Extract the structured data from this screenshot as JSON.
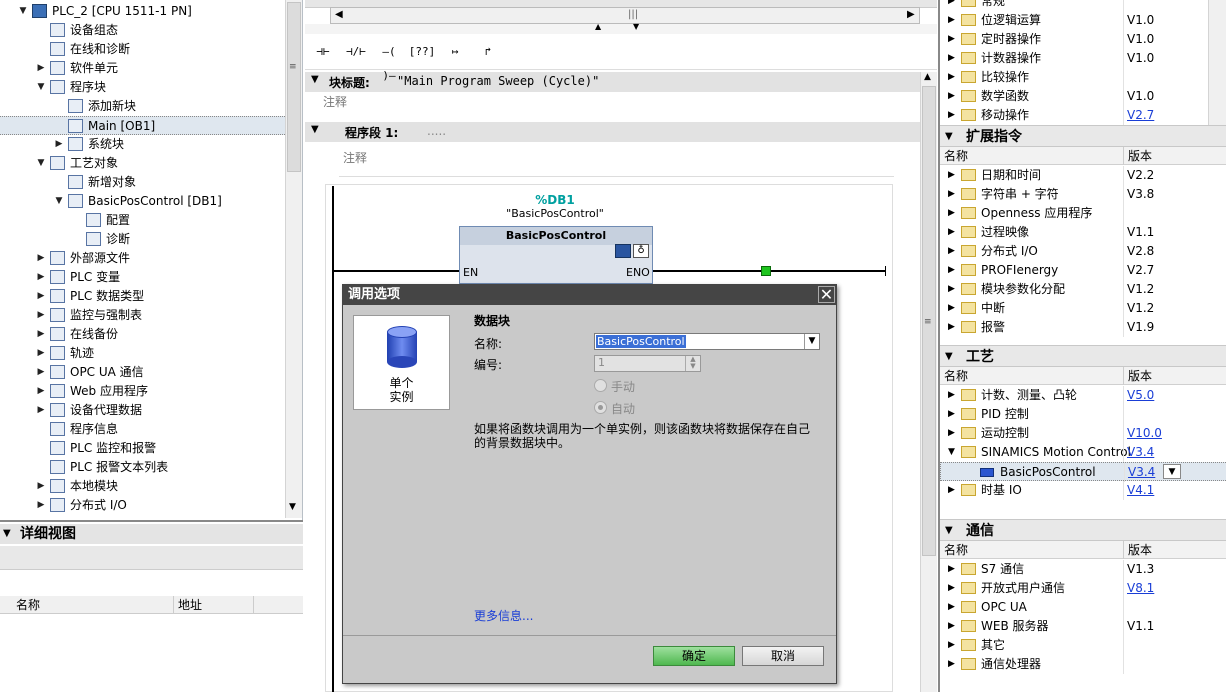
{
  "tree": {
    "root": "PLC_2 [CPU 1511-1 PN]",
    "items": [
      {
        "label": "设备组态",
        "icon": "device-config-icon",
        "arrow": ""
      },
      {
        "label": "在线和诊断",
        "icon": "online-diagnostics-icon",
        "arrow": ""
      },
      {
        "label": "软件单元",
        "icon": "software-unit-icon",
        "arrow": "▶"
      },
      {
        "label": "程序块",
        "icon": "program-blocks-icon",
        "arrow": "▼"
      },
      {
        "label": "添加新块",
        "icon": "add-block-icon",
        "arrow": ""
      },
      {
        "label": "Main [OB1]",
        "icon": "ob-block-icon",
        "arrow": ""
      },
      {
        "label": "系统块",
        "icon": "system-blocks-icon",
        "arrow": "▶"
      },
      {
        "label": "工艺对象",
        "icon": "technology-objects-icon",
        "arrow": "▼"
      },
      {
        "label": "新增对象",
        "icon": "add-object-icon",
        "arrow": ""
      },
      {
        "label": "BasicPosControl [DB1]",
        "icon": "axis-object-icon",
        "arrow": "▼"
      },
      {
        "label": "配置",
        "icon": "config-icon",
        "arrow": ""
      },
      {
        "label": "诊断",
        "icon": "diagnostics-icon",
        "arrow": ""
      },
      {
        "label": "外部源文件",
        "icon": "external-source-icon",
        "arrow": "▶"
      },
      {
        "label": "PLC 变量",
        "icon": "plc-tags-icon",
        "arrow": "▶"
      },
      {
        "label": "PLC 数据类型",
        "icon": "plc-datatype-icon",
        "arrow": "▶"
      },
      {
        "label": "监控与强制表",
        "icon": "watch-table-icon",
        "arrow": "▶"
      },
      {
        "label": "在线备份",
        "icon": "online-backup-icon",
        "arrow": "▶"
      },
      {
        "label": "轨迹",
        "icon": "trace-icon",
        "arrow": "▶"
      },
      {
        "label": "OPC UA 通信",
        "icon": "opcua-icon",
        "arrow": "▶"
      },
      {
        "label": "Web 应用程序",
        "icon": "web-app-icon",
        "arrow": "▶"
      },
      {
        "label": "设备代理数据",
        "icon": "device-proxy-icon",
        "arrow": "▶"
      },
      {
        "label": "程序信息",
        "icon": "program-info-icon",
        "arrow": ""
      },
      {
        "label": "PLC 监控和报警",
        "icon": "plc-alarms-icon",
        "arrow": ""
      },
      {
        "label": "PLC 报警文本列表",
        "icon": "alarm-text-icon",
        "arrow": ""
      },
      {
        "label": "本地模块",
        "icon": "local-modules-icon",
        "arrow": "▶"
      },
      {
        "label": "分布式 I/O",
        "icon": "distributed-io-icon",
        "arrow": "▶"
      }
    ]
  },
  "detail_view": {
    "title": "详细视图",
    "col_name": "名称",
    "col_address": "地址"
  },
  "editor": {
    "toolbar": [
      "⊣⊢",
      "⊣/⊢",
      "–( )–",
      "[??]",
      "↦",
      "↱"
    ],
    "block_title_label": "块标题:",
    "block_title_value": "\"Main Program Sweep (Cycle)\"",
    "comment": "注释",
    "network_label": "程序段 1:",
    "network_dots": ".....",
    "network_comment": "注释",
    "db_address": "%DB1",
    "db_name": "\"BasicPosControl\"",
    "fb_name": "BasicPosControl",
    "en": "EN",
    "eno": "ENO"
  },
  "dialog": {
    "title": "调用选项",
    "option_label_1": "单个",
    "option_label_2": "实例",
    "section": "数据块",
    "name_label": "名称:",
    "name_value": "BasicPosControl",
    "number_label": "编号:",
    "number_value": "1",
    "manual": "手动",
    "auto": "自动",
    "description": "如果将函数块调用为一个单实例，则该函数块将数据保存在自己的背景数据块中。",
    "more_info": "更多信息...",
    "ok": "确定",
    "cancel": "取消"
  },
  "right": {
    "top_rows": [
      {
        "name": "常规",
        "ver": ""
      },
      {
        "name": "位逻辑运算",
        "ver": "V1.0"
      },
      {
        "name": "定时器操作",
        "ver": "V1.0"
      },
      {
        "name": "计数器操作",
        "ver": "V1.0"
      },
      {
        "name": "比较操作",
        "ver": ""
      },
      {
        "name": "数学函数",
        "ver": "V1.0"
      },
      {
        "name": "移动操作",
        "ver": "V2.7",
        "link": true
      }
    ],
    "ext_title": "扩展指令",
    "col_name": "名称",
    "col_ver": "版本",
    "ext_rows": [
      {
        "name": "日期和时间",
        "ver": "V2.2"
      },
      {
        "name": "字符串 + 字符",
        "ver": "V3.8"
      },
      {
        "name": "Openness 应用程序",
        "ver": ""
      },
      {
        "name": "过程映像",
        "ver": "V1.1"
      },
      {
        "name": "分布式 I/O",
        "ver": "V2.8"
      },
      {
        "name": "PROFIenergy",
        "ver": "V2.7"
      },
      {
        "name": "模块参数化分配",
        "ver": "V1.2"
      },
      {
        "name": "中断",
        "ver": "V1.2"
      },
      {
        "name": "报警",
        "ver": "V1.9"
      }
    ],
    "tech_title": "工艺",
    "tech_rows": [
      {
        "name": "计数、测量、凸轮",
        "ver": "V5.0",
        "link": true
      },
      {
        "name": "PID 控制",
        "ver": ""
      },
      {
        "name": "运动控制",
        "ver": "V10.0",
        "link": true
      },
      {
        "name": "SINAMICS Motion Control",
        "ver": "V3.4",
        "link": true,
        "open": true
      },
      {
        "name": "BasicPosControl",
        "ver": "V3.4",
        "link": true,
        "child": true
      },
      {
        "name": "时基 IO",
        "ver": "V4.1",
        "link": true
      }
    ],
    "comm_title": "通信",
    "comm_rows": [
      {
        "name": "S7 通信",
        "ver": "V1.3"
      },
      {
        "name": "开放式用户通信",
        "ver": "V8.1",
        "link": true
      },
      {
        "name": "OPC UA",
        "ver": ""
      },
      {
        "name": "WEB 服务器",
        "ver": "V1.1"
      },
      {
        "name": "其它",
        "ver": ""
      },
      {
        "name": "通信处理器",
        "ver": ""
      }
    ]
  }
}
